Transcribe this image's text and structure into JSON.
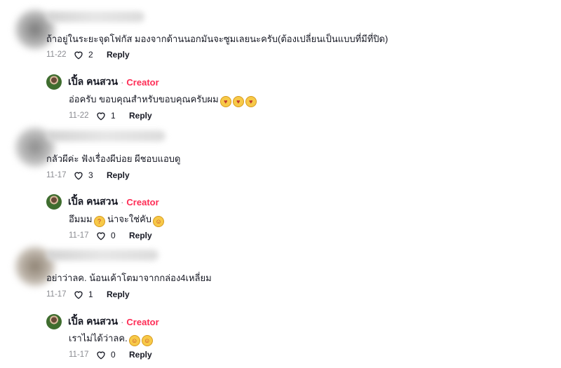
{
  "comments": [
    {
      "text": "ถ้าอยู่ในระยะจุดโฟกัส มองจากด้านนอกมันจะซูมเลยนะครับ(ต้องเปลี่ยนเป็นแบบที่มีที่ปิด)",
      "date": "11-22",
      "likes": "2",
      "reply_label": "Reply",
      "reply": {
        "name": "เปิ้ล คนสวน",
        "badge": "Creator",
        "separator": "·",
        "text": "อ่อครับ ขอบคุณสำหรับขอบคุณครับผม",
        "date": "11-22",
        "likes": "1",
        "reply_label": "Reply"
      }
    },
    {
      "text": "กลัวผีค่ะ ฟังเรื่องผีบ่อย ผีชอบแอบดู",
      "date": "11-17",
      "likes": "3",
      "reply_label": "Reply",
      "reply": {
        "name": "เปิ้ล คนสวน",
        "badge": "Creator",
        "separator": "·",
        "text_a": "อึมมม",
        "text_b": " น่าจะใช่คับ",
        "date": "11-17",
        "likes": "0",
        "reply_label": "Reply"
      }
    },
    {
      "text": "อย่าว่าลค. น้อนเค้าโตมาจากกล่อง4เหลี่ยม",
      "date": "11-17",
      "likes": "1",
      "reply_label": "Reply",
      "reply": {
        "name": "เปิ้ล คนสวน",
        "badge": "Creator",
        "separator": "·",
        "text": "เราไม่ได้ว่าลค.",
        "date": "11-17",
        "likes": "0",
        "reply_label": "Reply"
      }
    }
  ],
  "icons": {
    "like": "heart-outline-icon",
    "emoji": "emoji-icon"
  },
  "colors": {
    "creator": "#fe2c55",
    "meta": "#8a8b91",
    "text": "#161823"
  }
}
